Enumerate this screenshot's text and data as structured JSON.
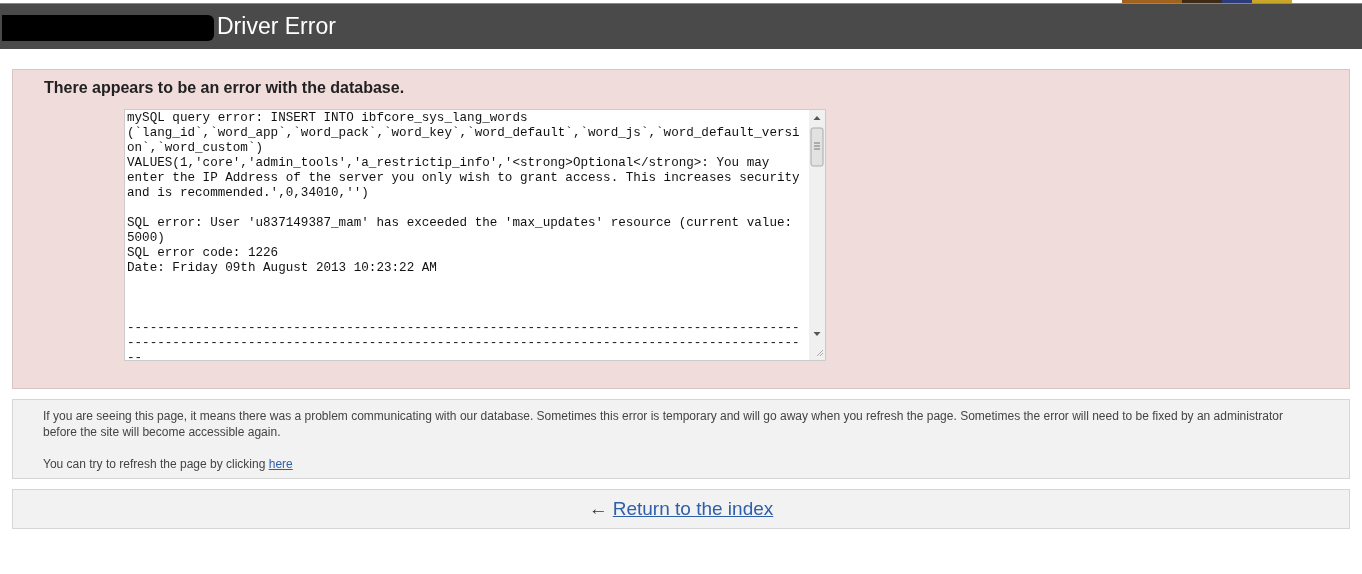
{
  "header": {
    "title": "Driver Error"
  },
  "error_panel": {
    "heading": "There appears to be an error with the database.",
    "log": "mySQL query error: INSERT INTO ibfcore_sys_lang_words (`lang_id`,`word_app`,`word_pack`,`word_key`,`word_default`,`word_js`,`word_default_version`,`word_custom`)\nVALUES(1,'core','admin_tools','a_restrictip_info','<strong>Optional</strong>: You may enter the IP Address of the server you only wish to grant access. This increases security and is recommended.',0,34010,'')\n\nSQL error: User 'u837149387_mam' has exceeded the 'max_updates' resource (current value: 5000)\nSQL error code: 1226\nDate: Friday 09th August 2013 10:23:22 AM\n\n\n\n------------------------------------------------------------------------------------------------------------------------------------------------------------------------------------"
  },
  "info_panel": {
    "message": "If you are seeing this page, it means there was a problem communicating with our database. Sometimes this error is temporary and will go away when you refresh the page. Sometimes the error will need to be fixed by an administrator before the site will become accessible again.",
    "refresh_text": "You can try to refresh the page by clicking",
    "refresh_link": "here"
  },
  "return_panel": {
    "arrow": "←",
    "link": "Return to the index"
  }
}
